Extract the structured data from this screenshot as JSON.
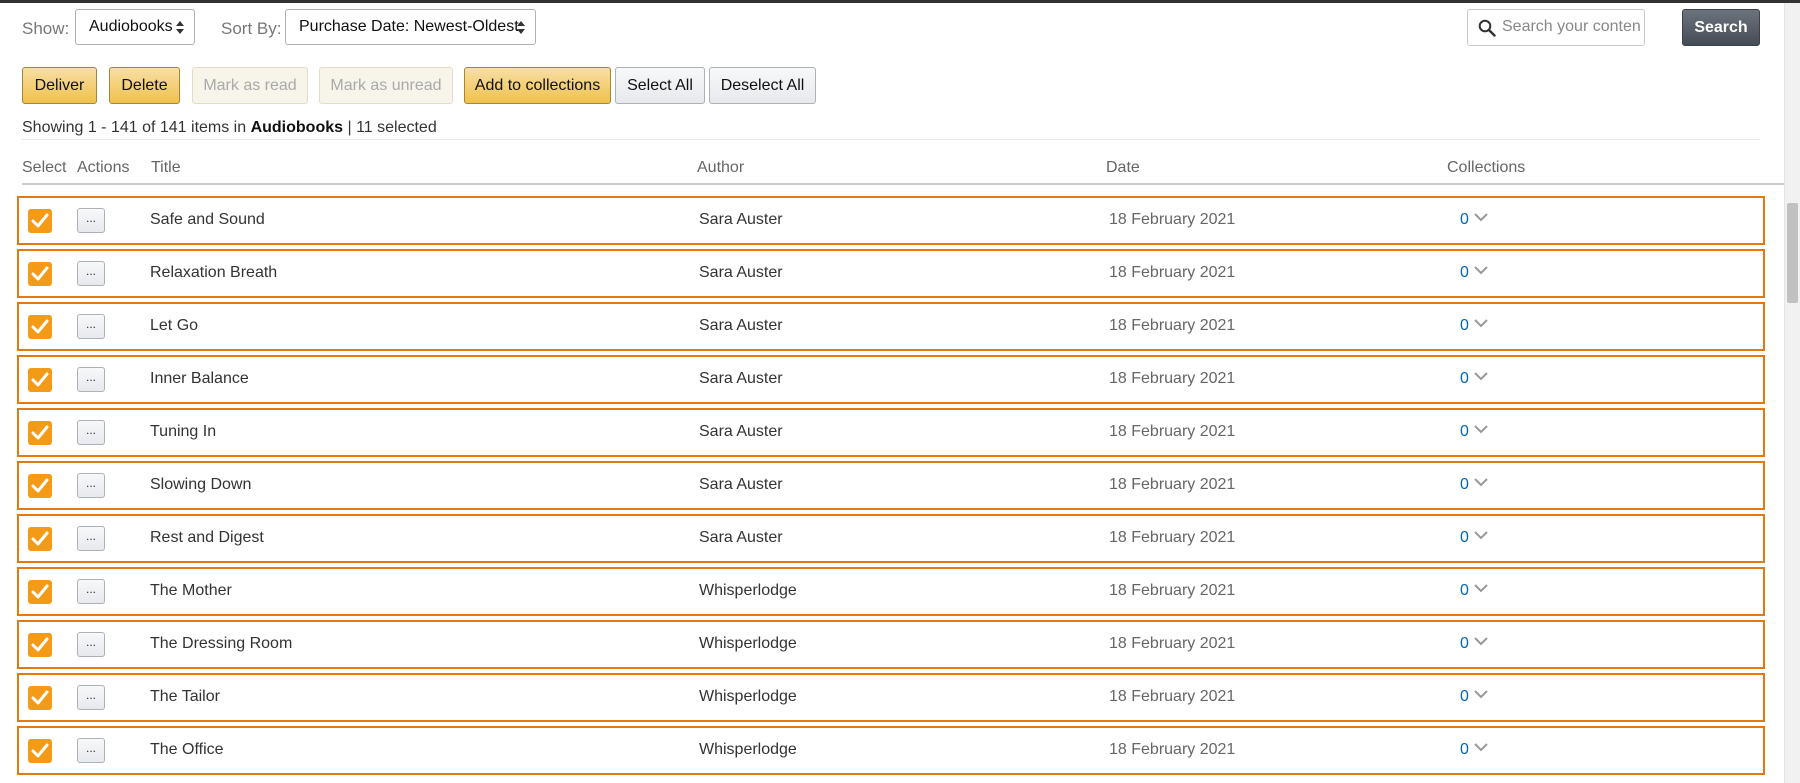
{
  "toolbar": {
    "show_label": "Show:",
    "show_value": "Audiobooks",
    "sort_label": "Sort By:",
    "sort_value": "Purchase Date: Newest-Oldest",
    "search_placeholder": "Search your content",
    "search_button": "Search"
  },
  "actions": {
    "deliver": "Deliver",
    "delete": "Delete",
    "mark_read": "Mark as read",
    "mark_unread": "Mark as unread",
    "add_collections": "Add to collections",
    "select_all": "Select All",
    "deselect_all": "Deselect All"
  },
  "summary": {
    "prefix": "Showing 1 - 141 of 141 items in ",
    "category": "Audiobooks",
    "suffix": " | 11 selected"
  },
  "columns": {
    "select": "Select",
    "actions": "Actions",
    "title": "Title",
    "author": "Author",
    "date": "Date",
    "collections": "Collections"
  },
  "rows": [
    {
      "title": "Safe and Sound",
      "author": "Sara Auster",
      "date": "18 February 2021",
      "collections": "0",
      "checked": true,
      "actions_label": "..."
    },
    {
      "title": "Relaxation Breath",
      "author": "Sara Auster",
      "date": "18 February 2021",
      "collections": "0",
      "checked": true,
      "actions_label": "..."
    },
    {
      "title": "Let Go",
      "author": "Sara Auster",
      "date": "18 February 2021",
      "collections": "0",
      "checked": true,
      "actions_label": "..."
    },
    {
      "title": "Inner Balance",
      "author": "Sara Auster",
      "date": "18 February 2021",
      "collections": "0",
      "checked": true,
      "actions_label": "..."
    },
    {
      "title": "Tuning In",
      "author": "Sara Auster",
      "date": "18 February 2021",
      "collections": "0",
      "checked": true,
      "actions_label": "..."
    },
    {
      "title": "Slowing Down",
      "author": "Sara Auster",
      "date": "18 February 2021",
      "collections": "0",
      "checked": true,
      "actions_label": "..."
    },
    {
      "title": "Rest and Digest",
      "author": "Sara Auster",
      "date": "18 February 2021",
      "collections": "0",
      "checked": true,
      "actions_label": "..."
    },
    {
      "title": "The Mother",
      "author": "Whisperlodge",
      "date": "18 February 2021",
      "collections": "0",
      "checked": true,
      "actions_label": "..."
    },
    {
      "title": "The Dressing Room",
      "author": "Whisperlodge",
      "date": "18 February 2021",
      "collections": "0",
      "checked": true,
      "actions_label": "..."
    },
    {
      "title": "The Tailor",
      "author": "Whisperlodge",
      "date": "18 February 2021",
      "collections": "0",
      "checked": true,
      "actions_label": "..."
    },
    {
      "title": "The Office",
      "author": "Whisperlodge",
      "date": "18 February 2021",
      "collections": "0",
      "checked": true,
      "actions_label": "..."
    }
  ],
  "colors": {
    "accent_orange": "#f39b16",
    "row_border": "#e47911",
    "link_blue": "#0066c0",
    "button_yellow": "#f0c14b"
  },
  "icons": {
    "search": "search-icon",
    "checkbox": "checkmark-icon",
    "collections_toggle": "chevron-down-icon"
  }
}
